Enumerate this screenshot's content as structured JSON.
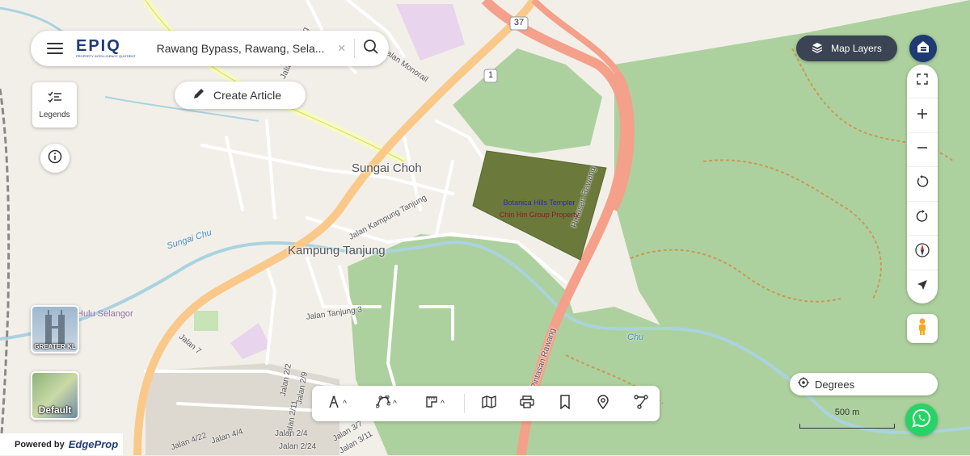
{
  "app": {
    "logo": "EPIQ",
    "logo_sub": "PROPERTY INTELLIGENCE QUOTIENT"
  },
  "search": {
    "value": "Rawang Bypass, Rawang, Sela...",
    "clear": "×"
  },
  "create_article": {
    "label": "Create Article"
  },
  "legends": {
    "label": "Legends"
  },
  "map_layers": {
    "label": "Map Layers"
  },
  "basemaps": [
    {
      "label": "GREATER KL"
    },
    {
      "label": "Default"
    }
  ],
  "bottom_tools": [
    "measure-icon",
    "polygon-draw-icon",
    "area-icon",
    "map-book-icon",
    "print-icon",
    "bookmark-icon",
    "location-pin-icon",
    "route-icon"
  ],
  "degrees": {
    "label": "Degrees"
  },
  "scale": {
    "label": "500 m"
  },
  "powered": {
    "prefix": "Powered by",
    "brand": "EdgeProp"
  },
  "map": {
    "places": [
      {
        "text": "Sungai Choh"
      },
      {
        "text": "Kampung Tanjung"
      }
    ],
    "road_shields": [
      "37",
      "1"
    ],
    "streets": [
      "Pintasan Rawang",
      "Pintasan Rawang",
      "Jalan Kampung Tanjung",
      "Jalan Tanjung 3",
      "Jalan 7",
      "Jalan Monorail",
      "Jalan Kampung",
      "Jalan 2/2",
      "Jalan 2/9",
      "Jalan 2/11",
      "Jalan 4/4",
      "Jalan 2/4",
      "Jalan 2/24",
      "Jalan 3/7",
      "Jalan 3/11",
      "Jalan 4/22"
    ],
    "waterways": [
      "Sungai Chu",
      "Hulu Selangor",
      "Chu"
    ],
    "plot": {
      "line1": "Botanica Hills Templer",
      "line2": "Chin Hin Group Property",
      "color": "#6b7a3a"
    }
  },
  "colors": {
    "accent": "#1f3b73",
    "motorway": "#f5a08a",
    "trunk": "#fac98a",
    "forest": "#add19e",
    "water": "#aad3df"
  }
}
